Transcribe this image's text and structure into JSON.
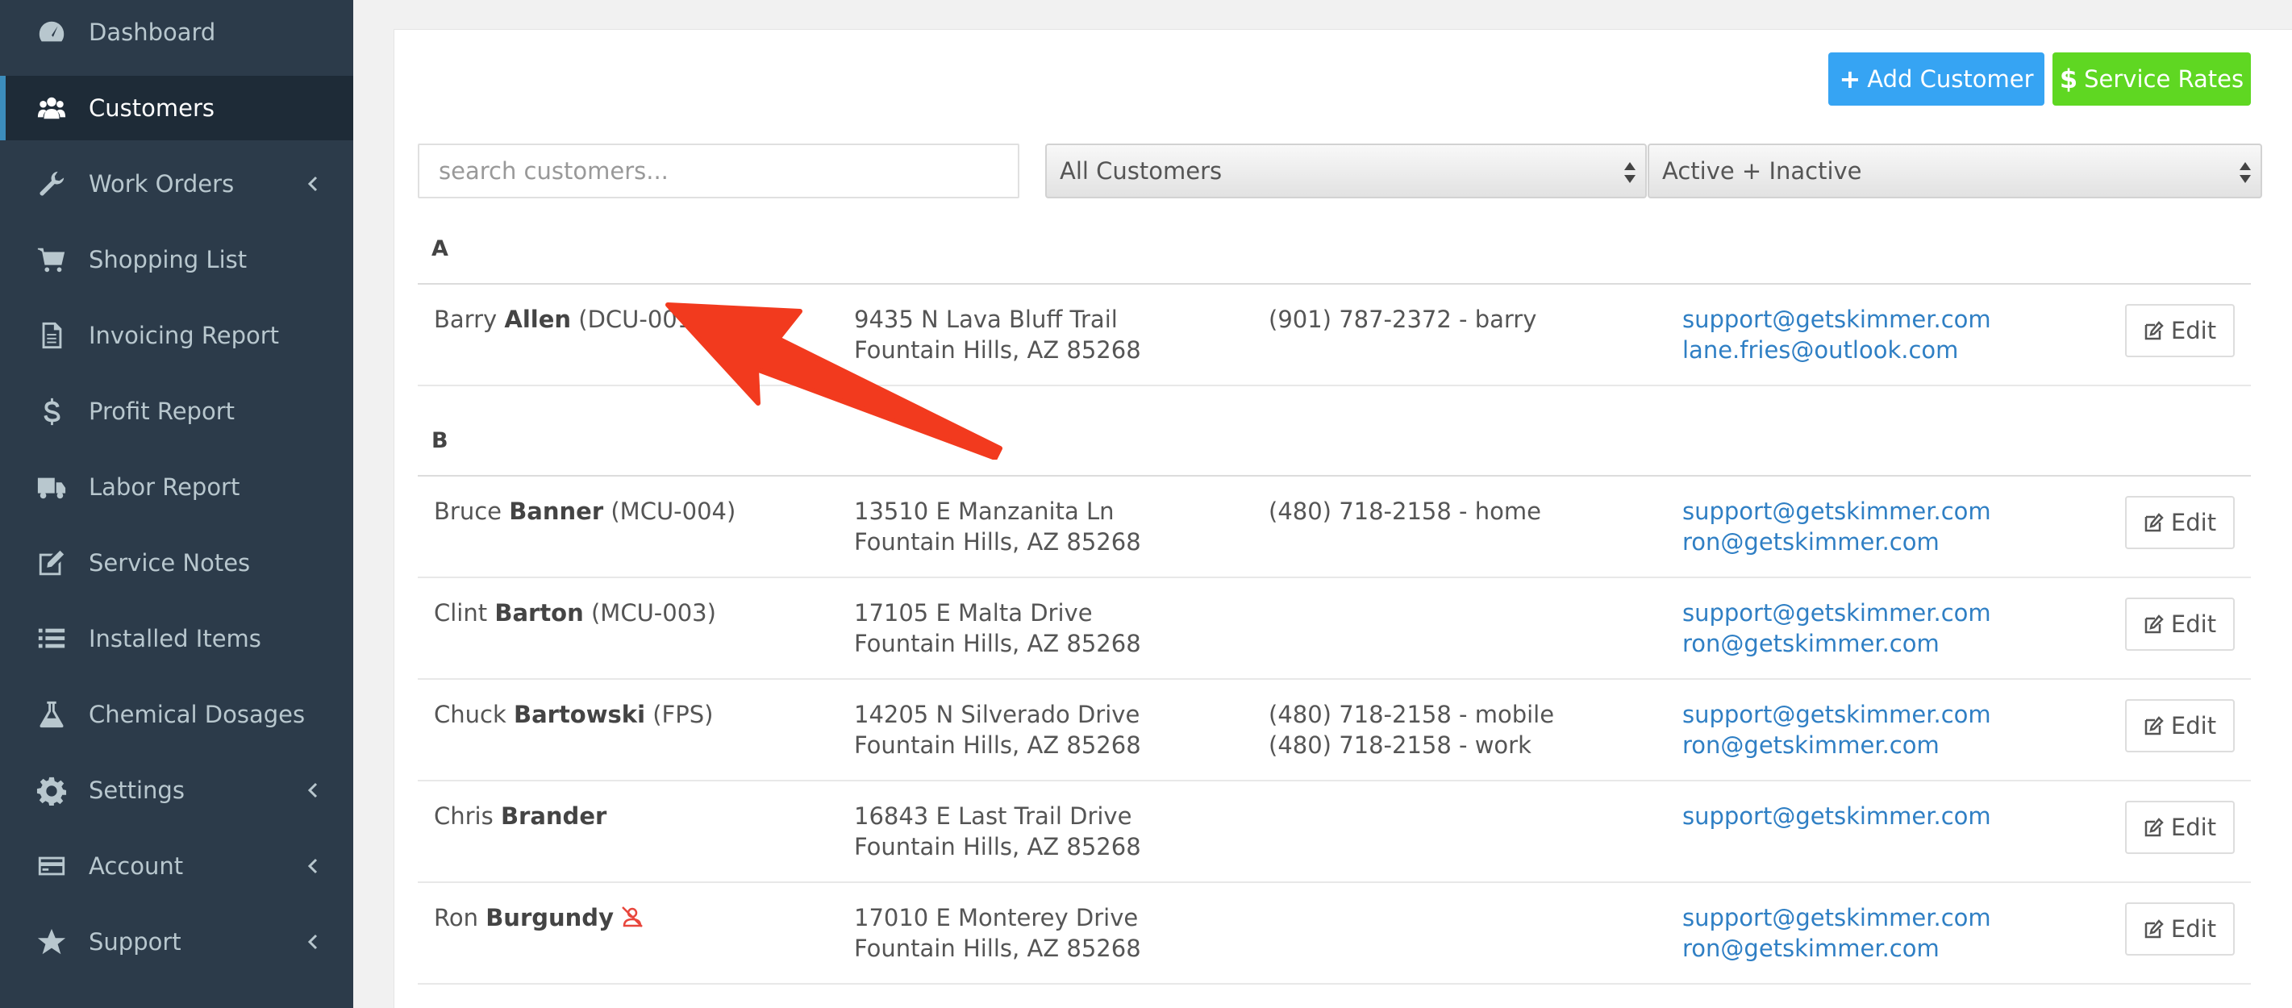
{
  "sidebar": {
    "items": [
      {
        "label": "Dashboard",
        "icon": "dashboard-icon",
        "has_chevron": false,
        "active": false
      },
      {
        "label": "Customers",
        "icon": "users-icon",
        "has_chevron": false,
        "active": true
      },
      {
        "label": "Work Orders",
        "icon": "wrench-icon",
        "has_chevron": true,
        "active": false
      },
      {
        "label": "Shopping List",
        "icon": "cart-icon",
        "has_chevron": false,
        "active": false
      },
      {
        "label": "Invoicing Report",
        "icon": "document-icon",
        "has_chevron": false,
        "active": false
      },
      {
        "label": "Profit Report",
        "icon": "dollar-icon",
        "has_chevron": false,
        "active": false
      },
      {
        "label": "Labor Report",
        "icon": "truck-icon",
        "has_chevron": false,
        "active": false
      },
      {
        "label": "Service Notes",
        "icon": "edit-note-icon",
        "has_chevron": false,
        "active": false
      },
      {
        "label": "Installed Items",
        "icon": "list-icon",
        "has_chevron": false,
        "active": false
      },
      {
        "label": "Chemical Dosages",
        "icon": "flask-icon",
        "has_chevron": false,
        "active": false
      },
      {
        "label": "Settings",
        "icon": "gear-icon",
        "has_chevron": true,
        "active": false
      },
      {
        "label": "Account",
        "icon": "credit-card-icon",
        "has_chevron": true,
        "active": false
      },
      {
        "label": "Support",
        "icon": "star-icon",
        "has_chevron": true,
        "active": false
      }
    ]
  },
  "toolbar": {
    "add_customer_label": "Add Customer",
    "add_customer_prefix": "+",
    "service_rates_label": "Service Rates",
    "service_rates_prefix": "$"
  },
  "filters": {
    "search_placeholder": "search customers...",
    "customer_filter": "All Customers",
    "status_filter": "Active + Inactive"
  },
  "groups": [
    {
      "letter": "A",
      "customers": [
        {
          "first": "Barry",
          "last": "Allen",
          "code": "(DCU-001)",
          "addr1": "9435 N Lava Bluff Trail",
          "addr2": "Fountain Hills, AZ 85268",
          "phone1": "(901) 787-2372 - barry",
          "phone2": "",
          "email1": "support@getskimmer.com",
          "email2": "lane.fries@outlook.com",
          "inactive": false
        }
      ]
    },
    {
      "letter": "B",
      "customers": [
        {
          "first": "Bruce",
          "last": "Banner",
          "code": "(MCU-004)",
          "addr1": "13510 E Manzanita Ln",
          "addr2": "Fountain Hills, AZ 85268",
          "phone1": "(480) 718-2158 - home",
          "phone2": "",
          "email1": "support@getskimmer.com",
          "email2": "ron@getskimmer.com",
          "inactive": false
        },
        {
          "first": "Clint",
          "last": "Barton",
          "code": "(MCU-003)",
          "addr1": "17105 E Malta Drive",
          "addr2": "Fountain Hills, AZ 85268",
          "phone1": "",
          "phone2": "",
          "email1": "support@getskimmer.com",
          "email2": "ron@getskimmer.com",
          "inactive": false
        },
        {
          "first": "Chuck",
          "last": "Bartowski",
          "code": "(FPS)",
          "addr1": "14205 N Silverado Drive",
          "addr2": "Fountain Hills, AZ 85268",
          "phone1": "(480) 718-2158 - mobile",
          "phone2": "(480) 718-2158 - work",
          "email1": "support@getskimmer.com",
          "email2": "ron@getskimmer.com",
          "inactive": false
        },
        {
          "first": "Chris",
          "last": "Brander",
          "code": "",
          "addr1": "16843 E Last Trail Drive",
          "addr2": "Fountain Hills, AZ 85268",
          "phone1": "",
          "phone2": "",
          "email1": "support@getskimmer.com",
          "email2": "",
          "inactive": false
        },
        {
          "first": "Ron",
          "last": "Burgundy",
          "code": "",
          "addr1": "17010 E Monterey Drive",
          "addr2": "Fountain Hills, AZ 85268",
          "phone1": "",
          "phone2": "",
          "email1": "support@getskimmer.com",
          "email2": "ron@getskimmer.com",
          "inactive": true
        }
      ]
    }
  ],
  "row_action_label": "Edit",
  "colors": {
    "sidebar_bg": "#2c3b4a",
    "active_bg": "#1e2b37",
    "add_button": "#36a4f3",
    "rates_button": "#5fd722",
    "link": "#2f7fc4",
    "annotation_arrow": "#f23a1e"
  }
}
